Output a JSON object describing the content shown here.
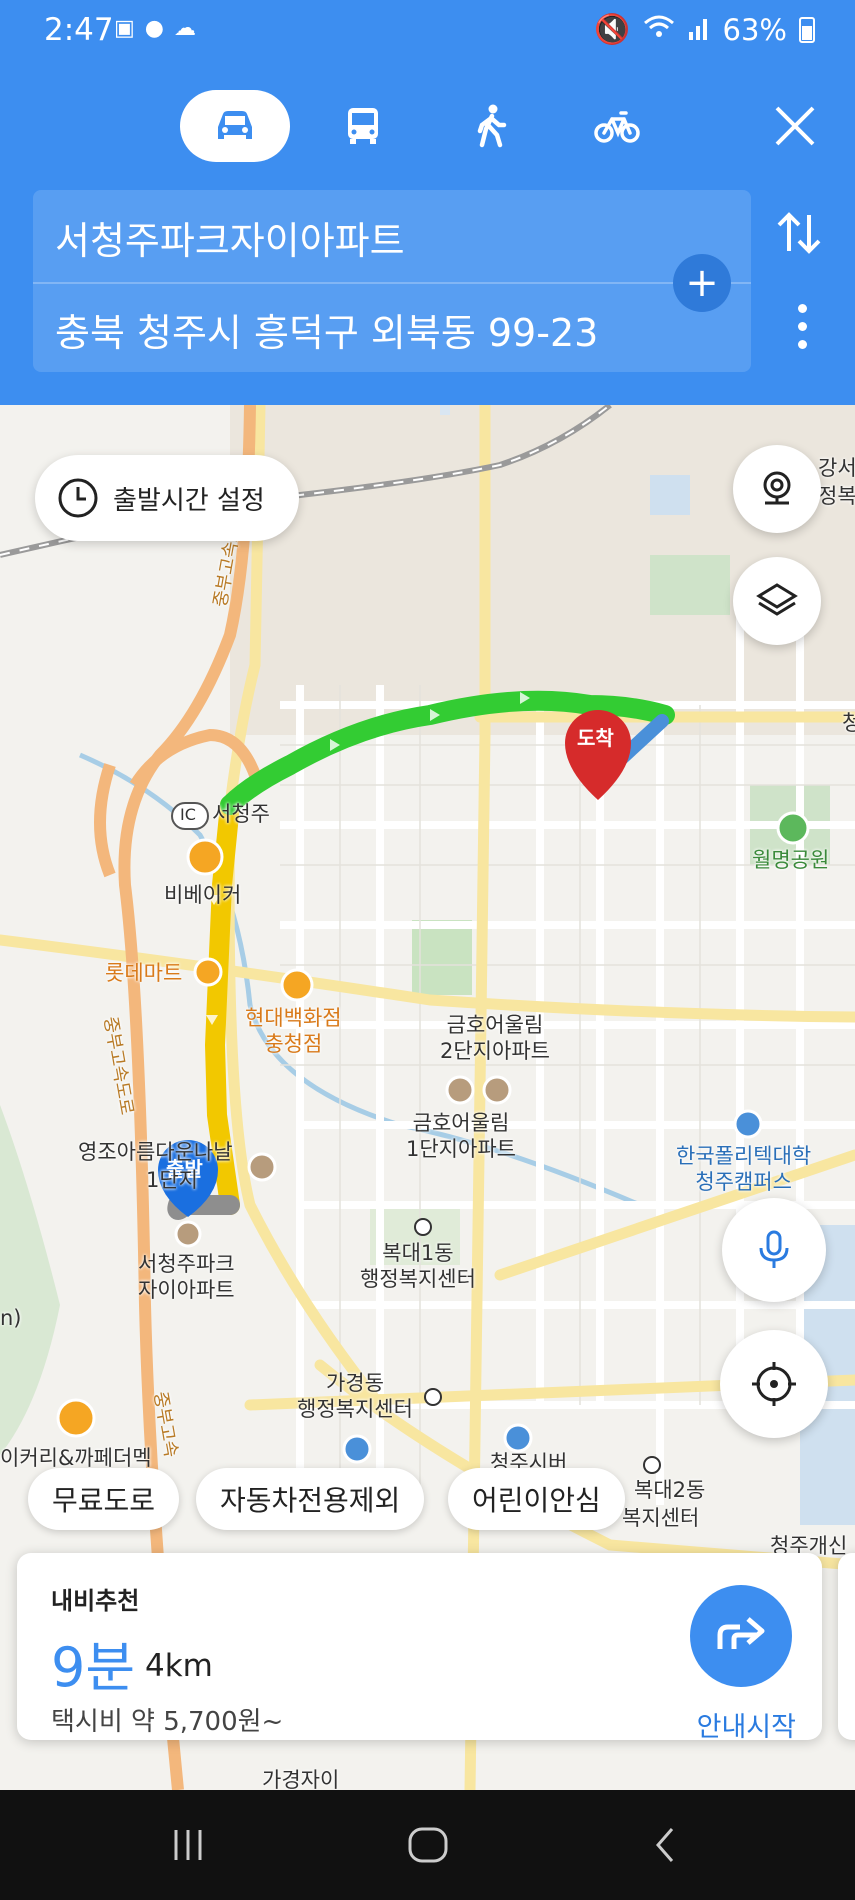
{
  "status_bar": {
    "time": "2:47",
    "battery": "63%"
  },
  "modes": [
    {
      "name": "car",
      "active": true
    },
    {
      "name": "bus",
      "active": false
    },
    {
      "name": "walk",
      "active": false
    },
    {
      "name": "bike",
      "active": false
    }
  ],
  "route": {
    "origin": "서청주파크자이아파트",
    "destination": "충북 청주시 흥덕구 외북동 99-23"
  },
  "map": {
    "depart_time_label": "출발시간 설정",
    "start_marker": "출발",
    "end_marker": "도착",
    "labels": {
      "seocheongju_ic": "서청주",
      "ic_badge": "IC",
      "bibeiker": "비베이커",
      "lotte_mart": "롯데마트",
      "hyundai_dept": "현대백화점\n충청점",
      "kumho2": "금호어울림\n2단지아파트",
      "kumho1": "금호어울림\n1단지아파트",
      "youngjo": "영조아름다운나날",
      "youngjo2": "1단지",
      "start_apt": "서청주파크\n자이아파트",
      "bokdae": "복대1동\n행정복지센터",
      "gagyeong": "가경동\n행정복지센터",
      "polytech": "한국폴리텍대학\n청주캠퍼스",
      "wolmyeong": "월명공원",
      "gangseo": "강서",
      "gangseo2": "정복",
      "bokdae2": "복대2동",
      "bokdae2b": "복지센터",
      "cheongju_gaesin": "청주개신",
      "bakery": "이커리&까페더멕",
      "expressway1": "중부고속도로",
      "expressway2": "중부고속도로",
      "expressway3": "중부고속",
      "gagyeong_bottom": "가경자이",
      "left_edge": "n)",
      "right_edge": "청",
      "edge_i": "이",
      "edge_i2": "이",
      "cheongju_sibeo": "청주시버"
    }
  },
  "filters": [
    "무료도로",
    "자동차전용제외",
    "어린이안심"
  ],
  "summary": {
    "title": "내비추천",
    "duration": "9분",
    "distance": "4km",
    "fare": "택시비 약 5,700원~",
    "start_nav": "안내시작"
  },
  "colors": {
    "header": "#3d8ef0",
    "route_fast": "#33cc33",
    "route_slow": "#f2c800",
    "start_marker": "#1a6fe0",
    "end_marker": "#d62b2b"
  }
}
